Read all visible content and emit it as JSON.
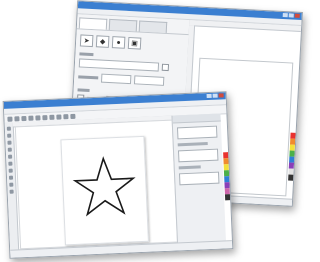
{
  "back_window": {
    "tabs": [
      "",
      "",
      ""
    ],
    "icons": [
      "arrow-icon",
      "fill-icon",
      "shape-icon",
      "frame-icon"
    ],
    "palette_colors": [
      "#e9322f",
      "#f08b2e",
      "#f3e03a",
      "#4bb04a",
      "#2f7fd6",
      "#8a3fb8",
      "#e3e3e3",
      "#333333"
    ]
  },
  "front_window": {
    "palette_colors": [
      "#e9322f",
      "#f08b2e",
      "#f3e03a",
      "#4bb04a",
      "#2f7fd6",
      "#8a3fb8",
      "#cc66aa",
      "#333333"
    ],
    "shape": "star"
  },
  "colors": {
    "titlebar": "#3b7fd1",
    "star_outline": "#1a1a1a"
  }
}
